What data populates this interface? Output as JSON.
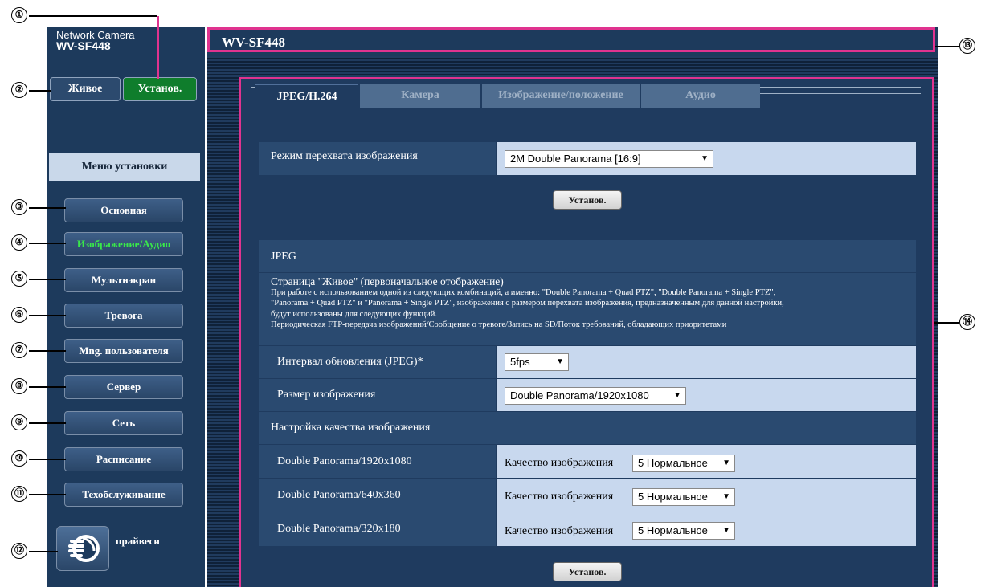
{
  "brand": {
    "line1": "Network Camera",
    "model": "WV-SF448"
  },
  "top_buttons": {
    "live": "Живое",
    "setup": "Установ."
  },
  "menu": {
    "heading": "Меню установки",
    "items": [
      "Основная",
      "Изображение/Аудио",
      "Мультиэкран",
      "Тревога",
      "Mng. пользователя",
      "Сервер",
      "Сеть",
      "Расписание",
      "Техобслуживание"
    ],
    "active_index": 1,
    "privacy_label": "прайвеси"
  },
  "header": {
    "title": "WV-SF448"
  },
  "tabs": [
    "JPEG/H.264",
    "Камера",
    "Изображение/положение",
    "Аудио"
  ],
  "capture_mode": {
    "label": "Режим перехвата изображения",
    "value": "2M Double Panorama [16:9]"
  },
  "set_button": "Установ.",
  "jpeg": {
    "section_title": "JPEG",
    "live_page_title": "Страница \"Живое\" (первоначальное отображение)",
    "note_lines": [
      "При работе с использованием одной из следующих комбинаций, а именно: \"Double Panorama + Quad PTZ\", \"Double Panorama + Single PTZ\",",
      "\"Panorama + Quad PTZ\" и \"Panorama + Single PTZ\", изображения с размером перехвата изображения, предназначенным для данной настройки,",
      "будут использованы для следующих функций.",
      "Периодическая FTP-передача изображений/Сообщение о тревоге/Запись на SD/Поток требований, обладающих приоритетами"
    ],
    "refresh_label": "Интервал обновления (JPEG)*",
    "refresh_value": "5fps",
    "size_label": "Размер изображения",
    "size_value": "Double Panorama/1920x1080",
    "quality_title": "Настройка качества изображения",
    "quality_rows": [
      {
        "label": "Double Panorama/1920x1080",
        "prefix": "Качество изображения",
        "value": "5 Нормальное"
      },
      {
        "label": "Double Panorama/640x360",
        "prefix": "Качество изображения",
        "value": "5 Нормальное"
      },
      {
        "label": "Double Panorama/320x180",
        "prefix": "Качество изображения",
        "value": "5 Нормальное"
      }
    ]
  },
  "callouts": [
    "①",
    "②",
    "③",
    "④",
    "⑤",
    "⑥",
    "⑦",
    "⑧",
    "⑨",
    "⑩",
    "⑪",
    "⑫",
    "⑬",
    "⑭"
  ],
  "colors": {
    "sidebar": "#1d3a5c",
    "active_green": "#39e84a",
    "label_cell": "#2a4a70",
    "value_cell": "#c8d8ee",
    "annotation": "#e0338f"
  }
}
